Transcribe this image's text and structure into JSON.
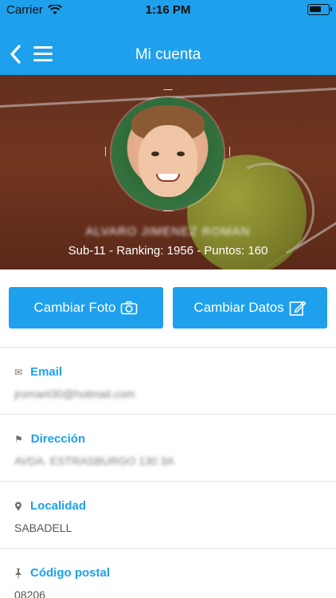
{
  "status_bar": {
    "carrier": "Carrier",
    "time": "1:16 PM"
  },
  "nav": {
    "title": "Mi cuenta"
  },
  "profile": {
    "name": "ALVARO JIMENEZ ROMAN",
    "summary": "Sub-11 - Ranking: 1956 - Puntos: 160"
  },
  "actions": {
    "change_photo": "Cambiar Foto",
    "change_data": "Cambiar Datos"
  },
  "fields": {
    "email": {
      "label": "Email",
      "value": "jromanl30@hotmail.com"
    },
    "address": {
      "label": "Dirección",
      "value": "AVDA. ESTRASBURGO 130 3A"
    },
    "locality": {
      "label": "Localidad",
      "value": "SABADELL"
    },
    "postal": {
      "label": "Código postal",
      "value": "08206"
    }
  },
  "colors": {
    "accent": "#1ea0ec",
    "hero_clay": "#8b4227",
    "text_muted": "#555555"
  }
}
